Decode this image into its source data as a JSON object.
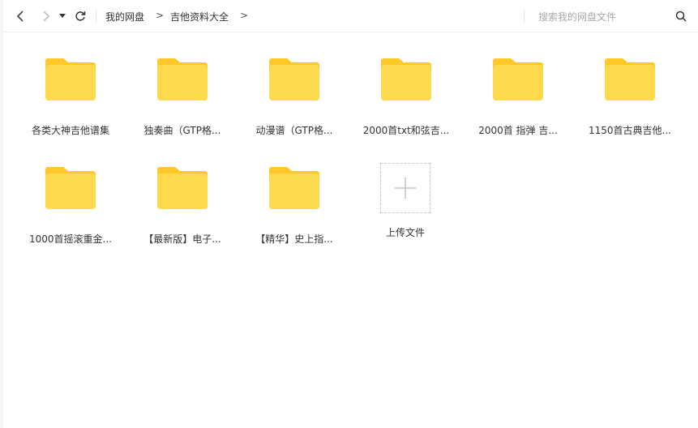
{
  "toolbar": {
    "breadcrumbs": [
      "我的网盘",
      "吉他资料大全"
    ],
    "separator": ">",
    "search_placeholder": "搜索我的网盘文件"
  },
  "folders": [
    {
      "name": "各类大神吉他谱集"
    },
    {
      "name": "独奏曲（GTP格..."
    },
    {
      "name": "动漫谱（GTP格..."
    },
    {
      "name": "2000首txt和弦吉..."
    },
    {
      "name": "2000首 指弹 吉..."
    },
    {
      "name": "1150首古典吉他..."
    },
    {
      "name": "1000首摇滚重金..."
    },
    {
      "name": "【最新版】电子..."
    },
    {
      "name": "【精华】史上指..."
    }
  ],
  "upload": {
    "label": "上传文件"
  },
  "colors": {
    "folder": "#FFD94D",
    "folder_tab": "#FFC728",
    "accent_text": "#333333"
  }
}
